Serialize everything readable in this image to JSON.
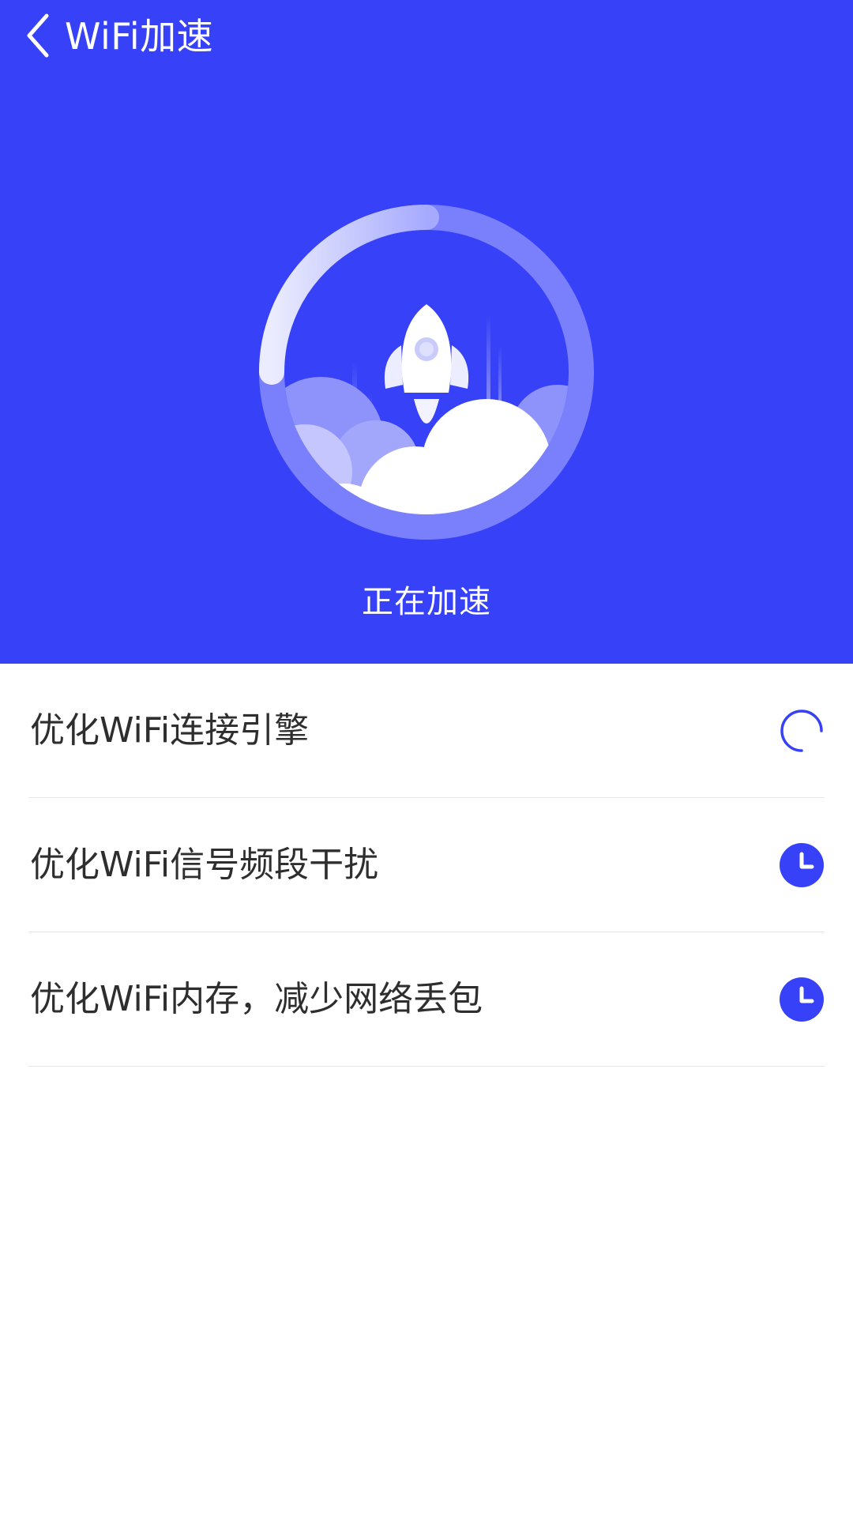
{
  "header": {
    "title": "WiFi加速"
  },
  "hero": {
    "status": "正在加速",
    "progress": 0.8
  },
  "tasks": [
    {
      "label": "优化WiFi连接引擎",
      "state": "in-progress",
      "icon": "loading-spinner-icon"
    },
    {
      "label": "优化WiFi信号频段干扰",
      "state": "pending",
      "icon": "clock-icon"
    },
    {
      "label": "优化WiFi内存，减少网络丢包",
      "state": "pending",
      "icon": "clock-icon"
    }
  ],
  "colors": {
    "primary": "#3641f8",
    "ring": "#7a80fb",
    "text": "#2e2e2e",
    "divider": "#e6e6e6"
  }
}
